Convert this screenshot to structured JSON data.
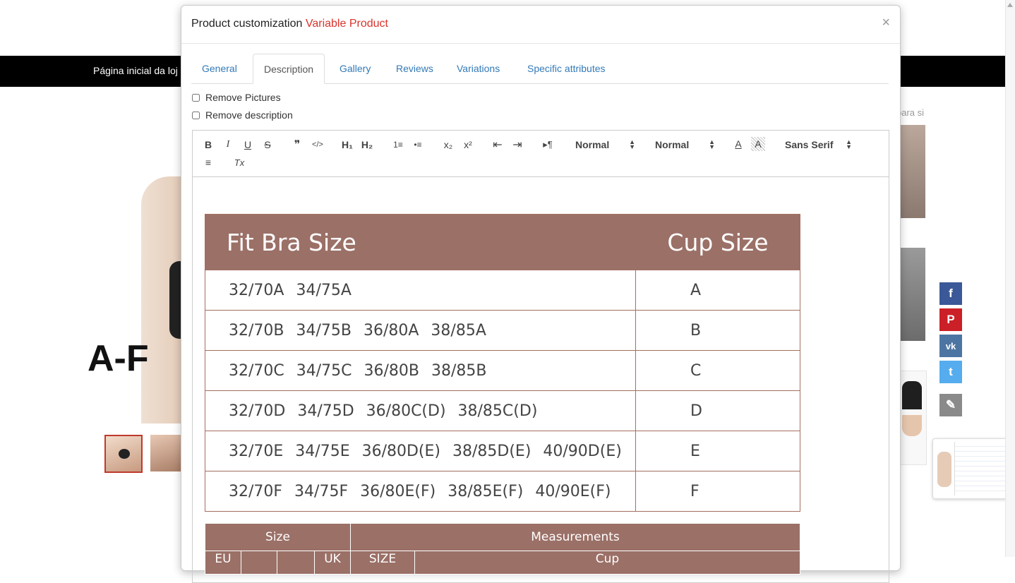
{
  "background": {
    "store_link": "Página inicial da loj",
    "hero_text": "A-F",
    "side_text": "para si",
    "social": {
      "facebook": "f",
      "pinterest": "P",
      "vk": "vk",
      "twitter": "t",
      "edit": "✎"
    }
  },
  "modal": {
    "title": "Product customization",
    "title_accent": "Variable Product",
    "close": "×",
    "tabs": [
      {
        "label": "General"
      },
      {
        "label": "Description"
      },
      {
        "label": "Gallery"
      },
      {
        "label": "Reviews"
      },
      {
        "label": "Variations"
      },
      {
        "label": "Specific attributes"
      }
    ],
    "active_tab": "Description",
    "options": {
      "remove_pictures": "Remove Pictures",
      "remove_description": "Remove description"
    },
    "toolbar": {
      "bold": "B",
      "italic": "I",
      "underline": "U",
      "strike": "S",
      "quote": "❞",
      "code": "</>",
      "h1": "H₁",
      "h2": "H₂",
      "ordered_list": "1≡",
      "bullet_list": "•≡",
      "subscript": "x₂",
      "superscript": "x²",
      "outdent": "⇤",
      "indent": "⇥",
      "direction": "▸¶",
      "size_select": "Normal",
      "header_select": "Normal",
      "color": "A",
      "background": "A",
      "font_select": "Sans Serif",
      "align": "≡",
      "clean": "Tx"
    }
  },
  "size_chart": {
    "headers": {
      "fit": "Fit Bra Size",
      "cup": "Cup Size"
    },
    "rows": [
      {
        "sizes": "32/70A 34/75A",
        "cup": "A"
      },
      {
        "sizes": "32/70B 34/75B 36/80A 38/85A",
        "cup": "B"
      },
      {
        "sizes": "32/70C 34/75C 36/80B 38/85B",
        "cup": "C"
      },
      {
        "sizes": "32/70D 34/75D 36/80C(D) 38/85C(D)",
        "cup": "D"
      },
      {
        "sizes": "32/70E 34/75E 36/80D(E) 38/85D(E) 40/90D(E)",
        "cup": "E"
      },
      {
        "sizes": "32/70F 34/75F 36/80E(F) 38/85E(F) 40/90E(F)",
        "cup": "F"
      }
    ],
    "measurements": {
      "size": "Size",
      "measurements": "Measurements",
      "sub": {
        "eu": "EU",
        "uk": "UK",
        "size": "SIZE",
        "cup": "Cup"
      }
    }
  }
}
